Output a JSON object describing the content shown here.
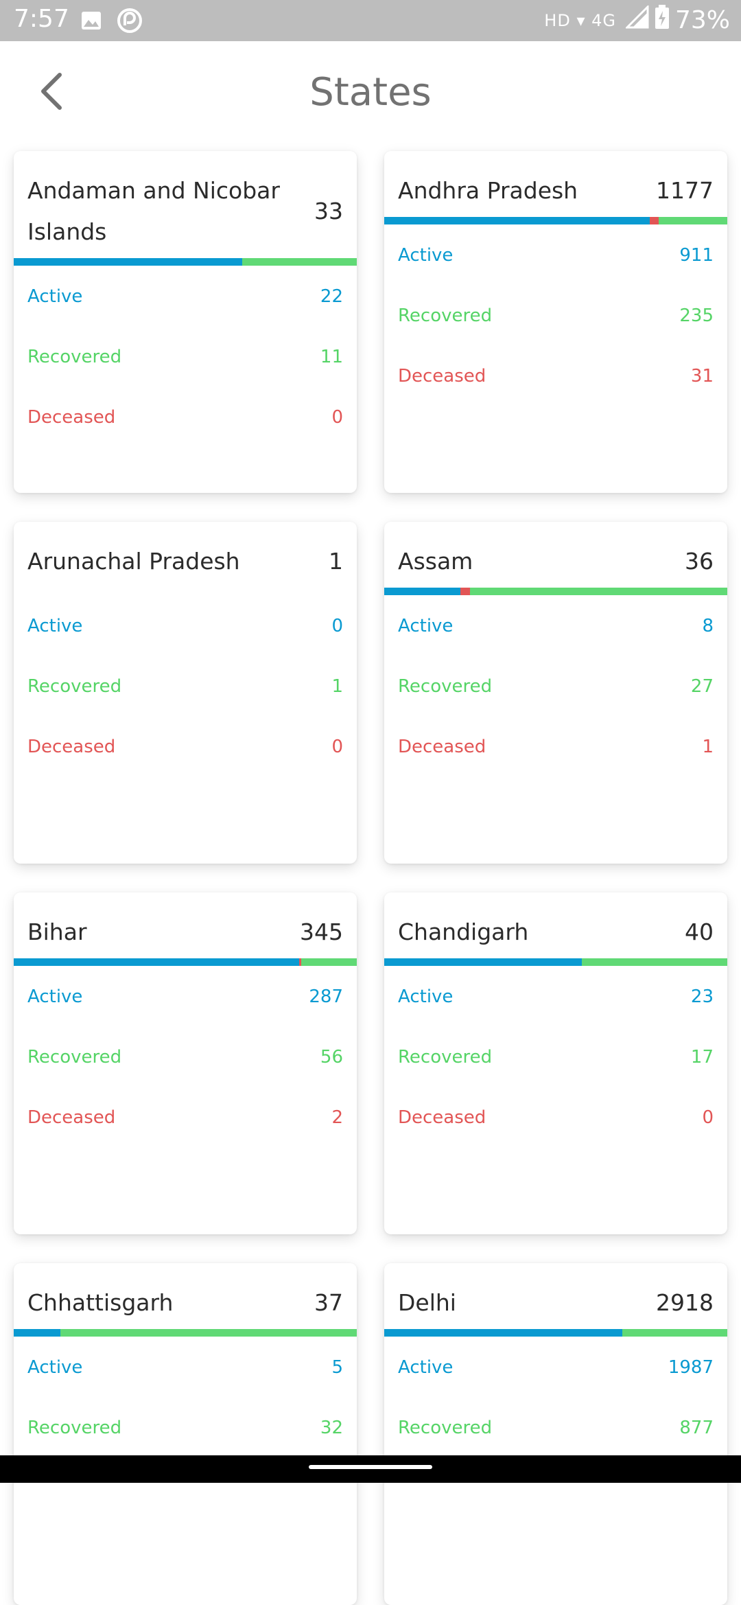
{
  "status_bar": {
    "time": "7:57",
    "network": "HD ▾ 4G",
    "battery": "73%",
    "icons": [
      "image-icon",
      "sync-icon",
      "signal-icon",
      "battery-charging-icon"
    ]
  },
  "header": {
    "title": "States",
    "back_icon": "chevron-left-icon"
  },
  "colors": {
    "active": "#0a9ad1",
    "recovered": "#60d975",
    "deceased": "#e25555"
  },
  "labels": {
    "active": "Active",
    "recovered": "Recovered",
    "deceased": "Deceased"
  },
  "states": [
    {
      "name": "Andaman and Nicobar Islands",
      "total": "33",
      "active": "22",
      "recovered": "11",
      "deceased": "0"
    },
    {
      "name": "Andhra Pradesh",
      "total": "1177",
      "active": "911",
      "recovered": "235",
      "deceased": "31"
    },
    {
      "name": "Arunachal Pradesh",
      "total": "1",
      "active": "0",
      "recovered": "1",
      "deceased": "0"
    },
    {
      "name": "Assam",
      "total": "36",
      "active": "8",
      "recovered": "27",
      "deceased": "1"
    },
    {
      "name": "Bihar",
      "total": "345",
      "active": "287",
      "recovered": "56",
      "deceased": "2"
    },
    {
      "name": "Chandigarh",
      "total": "40",
      "active": "23",
      "recovered": "17",
      "deceased": "0"
    },
    {
      "name": "Chhattisgarh",
      "total": "37",
      "active": "5",
      "recovered": "32",
      "deceased": ""
    },
    {
      "name": "Delhi",
      "total": "2918",
      "active": "1987",
      "recovered": "877",
      "deceased": ""
    }
  ]
}
